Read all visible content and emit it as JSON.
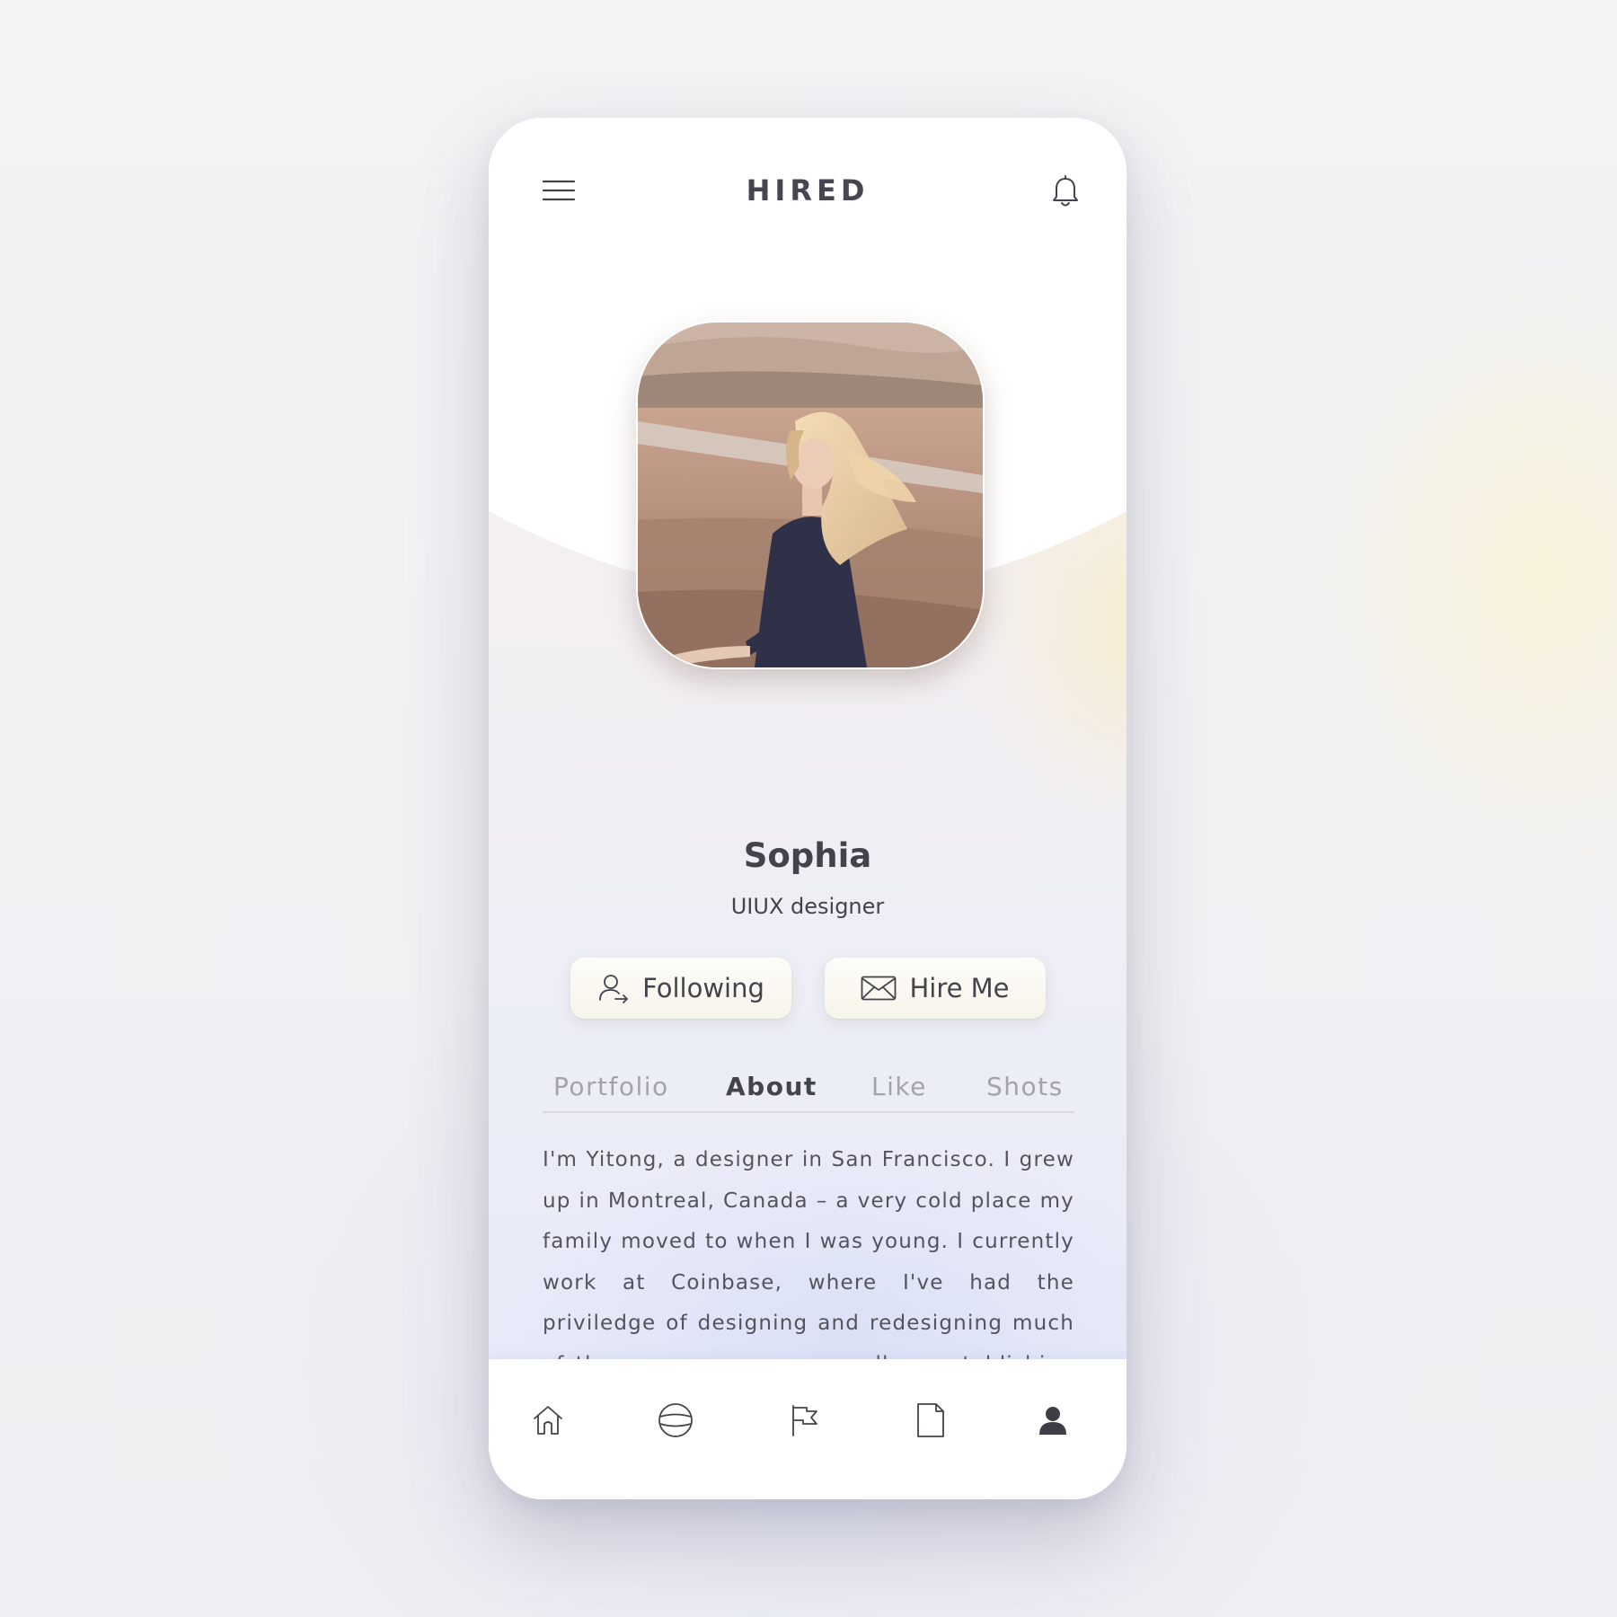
{
  "app": {
    "brand": "HIRED"
  },
  "header": {
    "menu_icon": "hamburger-menu-icon",
    "notification_icon": "bell-icon"
  },
  "profile": {
    "name": "Sophia",
    "role": "UIUX designer",
    "photo": "profile-photo-woman-in-field"
  },
  "actions": {
    "following_label": "Following",
    "following_icon": "user-follow-icon",
    "hire_label": "Hire Me",
    "hire_icon": "envelope-icon"
  },
  "tabs": [
    {
      "label": "Portfolio",
      "active": false
    },
    {
      "label": "About",
      "active": true
    },
    {
      "label": "Like",
      "active": false
    },
    {
      "label": "Shots",
      "active": false
    }
  ],
  "about": {
    "text": "I'm Yitong, a designer in San Francisco. I grew up in Montreal, Canada – a very cold place my family moved to when I was young. I currently work at Coinbase, where I've had the priviledge of designing and redesigning much of the consumer app, as well as establishing the design system."
  },
  "bottom_nav": [
    {
      "icon": "home-icon",
      "active": false
    },
    {
      "icon": "globe-icon",
      "active": false
    },
    {
      "icon": "flag-icon",
      "active": false
    },
    {
      "icon": "document-icon",
      "active": false
    },
    {
      "icon": "profile-icon",
      "active": true
    }
  ],
  "colors": {
    "text_primary": "#44434c",
    "text_muted": "#a3a3ab",
    "button_bg": "#fbf9f2",
    "accent_warm": "#f7ecd0",
    "accent_cool": "#dbe0f6"
  }
}
